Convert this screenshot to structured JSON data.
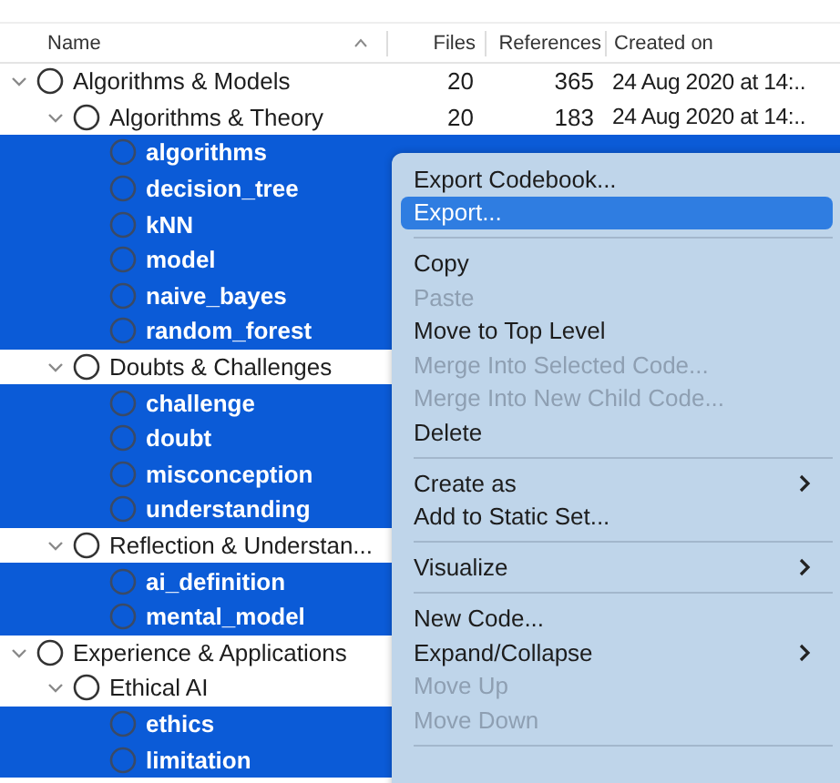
{
  "columns": [
    {
      "label": "Name",
      "sorted": true
    },
    {
      "label": "Files",
      "sorted": false
    },
    {
      "label": "References",
      "sorted": false
    },
    {
      "label": "Created on",
      "sorted": false
    }
  ],
  "tree": [
    {
      "name": "Algorithms & Models",
      "files": "20",
      "references": "365",
      "created": "24 Aug 2020 at 14:..",
      "selected": false,
      "expanded": true,
      "children": [
        {
          "name": "Algorithms & Theory",
          "files": "20",
          "references": "183",
          "created": "24 Aug 2020 at 14:..",
          "selected": false,
          "expanded": true,
          "children": [
            {
              "name": "algorithms",
              "selected": true
            },
            {
              "name": "decision_tree",
              "selected": true
            },
            {
              "name": "kNN",
              "selected": true
            },
            {
              "name": "model",
              "selected": true
            },
            {
              "name": "naive_bayes",
              "selected": true
            },
            {
              "name": "random_forest",
              "selected": true
            }
          ]
        },
        {
          "name": "Doubts & Challenges",
          "selected": false,
          "expanded": true,
          "children": [
            {
              "name": "challenge",
              "selected": true
            },
            {
              "name": "doubt",
              "selected": true
            },
            {
              "name": "misconception",
              "selected": true
            },
            {
              "name": "understanding",
              "selected": true
            }
          ]
        },
        {
          "name": "Reflection & Understan...",
          "selected": false,
          "expanded": true,
          "children": [
            {
              "name": "ai_definition",
              "selected": true
            },
            {
              "name": "mental_model",
              "selected": true
            }
          ]
        }
      ]
    },
    {
      "name": "Experience & Applications",
      "selected": false,
      "expanded": true,
      "children": [
        {
          "name": "Ethical AI",
          "selected": false,
          "expanded": true,
          "children": [
            {
              "name": "ethics",
              "selected": true
            },
            {
              "name": "limitation",
              "selected": true
            }
          ]
        }
      ]
    }
  ],
  "context_menu": [
    {
      "kind": "item",
      "label": "Export Codebook...",
      "disabled": false,
      "selected": false,
      "submenu": false
    },
    {
      "kind": "item",
      "label": "Export...",
      "disabled": false,
      "selected": true,
      "submenu": false
    },
    {
      "kind": "separator"
    },
    {
      "kind": "item",
      "label": "Copy",
      "disabled": false,
      "selected": false,
      "submenu": false
    },
    {
      "kind": "item",
      "label": "Paste",
      "disabled": true,
      "selected": false,
      "submenu": false
    },
    {
      "kind": "item",
      "label": "Move to Top Level",
      "disabled": false,
      "selected": false,
      "submenu": false
    },
    {
      "kind": "item",
      "label": "Merge Into Selected Code...",
      "disabled": true,
      "selected": false,
      "submenu": false
    },
    {
      "kind": "item",
      "label": "Merge Into New Child Code...",
      "disabled": true,
      "selected": false,
      "submenu": false
    },
    {
      "kind": "item",
      "label": "Delete",
      "disabled": false,
      "selected": false,
      "submenu": false
    },
    {
      "kind": "separator"
    },
    {
      "kind": "item",
      "label": "Create as",
      "disabled": false,
      "selected": false,
      "submenu": true
    },
    {
      "kind": "item",
      "label": "Add to Static Set...",
      "disabled": false,
      "selected": false,
      "submenu": false
    },
    {
      "kind": "separator"
    },
    {
      "kind": "item",
      "label": "Visualize",
      "disabled": false,
      "selected": false,
      "submenu": true
    },
    {
      "kind": "separator"
    },
    {
      "kind": "item",
      "label": "New Code...",
      "disabled": false,
      "selected": false,
      "submenu": false
    },
    {
      "kind": "item",
      "label": "Expand/Collapse",
      "disabled": false,
      "selected": false,
      "submenu": true
    },
    {
      "kind": "item",
      "label": "Move Up",
      "disabled": true,
      "selected": false,
      "submenu": false
    },
    {
      "kind": "item",
      "label": "Move Down",
      "disabled": true,
      "selected": false,
      "submenu": false
    },
    {
      "kind": "separator"
    }
  ]
}
